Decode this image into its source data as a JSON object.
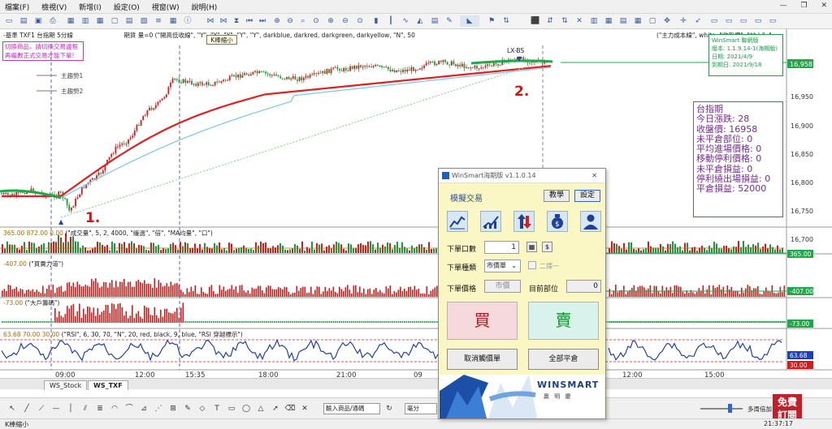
{
  "menubar": {
    "items": [
      "檔案(F)",
      "檢視(V)",
      "新增(I)",
      "設定(O)",
      "視窗(W)",
      "說明(H)"
    ]
  },
  "toolbar": {
    "tooltip": "K棒縮小"
  },
  "chart_header": {
    "left": "-基準 TXF1 台指期 5分線",
    "text": "期貨 量=0",
    "formula": "(\"開高低收線\", \"Y\", \"Y\", \"Y\", \"Y\", \"Y\", darkblue, darkred, darkgreen, darkyellow, \"N\", 50",
    "right_formula": "(\"主力成本線\", white, \"收盤價\", \"站上\", \"..."
  },
  "warning": {
    "line1": "切換商品，請切換交易邊框",
    "line2": "再繼數正式交易才能下單!"
  },
  "labels": {
    "main1": "主趨勢1",
    "main2": "主趨勢2",
    "marker": "LX-BS",
    "num1": "1.",
    "num2": "2."
  },
  "wsinfo": {
    "line1": "WinSmart 聯網版",
    "line2": "版本: 1.1.9.14-1(海期版)",
    "line3": "日期: 2021/4/9",
    "line4": "到期日: 2021/9/18"
  },
  "price_axis": {
    "ticks": [
      "16,950",
      "16,900",
      "16,850",
      "16,800",
      "16,750",
      "16,700"
    ],
    "current": "16,958"
  },
  "infobox": {
    "title": "台指期",
    "lines": [
      "今日漲跌: 28",
      "收盤價: 16958",
      "未平倉部位: 0",
      "平均進場價格: 0",
      "移動停利價格: 0",
      "未平倉損益: 0",
      "停利繞出場損益: 0",
      "平倉損益: 52000"
    ]
  },
  "sub1": {
    "vals": "365.00  872.00  0.00",
    "formula": "(\"成交量\", 5, 2, 4000, \"緩過\", \"倍\", \"MA均量\", \"口\")",
    "right": "365.00"
  },
  "sub2": {
    "vals": "-407.00",
    "formula": "(\"買賣力道\")",
    "right": "-407.00"
  },
  "sub3": {
    "vals": "-73.00",
    "formula": "(\"大戶籌碼\")",
    "right": "-73.00"
  },
  "sub4": {
    "vals": "63.68  70.00  30.00",
    "formula": "(\"RSI\", 6, 30, 70, \"N\", 20, red, black, 9, blue, \"RSI 穿越標示\")",
    "right1": "63.68",
    "right2": "30.00"
  },
  "time_axis": [
    "09:00",
    "12:00",
    "15:35",
    "18:00",
    "21:00",
    "09",
    "12:00",
    "15:00"
  ],
  "tabs": [
    "WS_Stock",
    "WS_TXF"
  ],
  "drawbar": {
    "dropdown": "輸入商品/通碼",
    "period": "毫分",
    "right_label": "多周倍加"
  },
  "free_badge": {
    "line1": "免費",
    "line2": "訂閱"
  },
  "status": {
    "left": "K棒縮小",
    "time": "21:37:17"
  },
  "dialog": {
    "title": "WinSmart海期版 v1.1.0.14",
    "section": "模擬交易",
    "tutorial": "教學",
    "settings": "設定",
    "qty_label": "下單口數",
    "qty_value": "1",
    "type_label": "下單種類",
    "type_value": "市價單",
    "check_label": "二擇一",
    "price_label": "下單價格",
    "price_value": "市價",
    "position_label": "目前部位",
    "position_value": "0",
    "buy": "買",
    "sell": "賣",
    "cancel_orders": "取消觸價單",
    "close_all": "全部平倉",
    "brand": "WINSMART",
    "brand_sub": "贏 明 慶"
  },
  "colors": {
    "ma_red": "#e02020",
    "ma_green": "#1fa84a",
    "candle_up": "#d21c1c",
    "candle_dn": "#1a9a3a",
    "rsi": "#1f3fb5"
  }
}
